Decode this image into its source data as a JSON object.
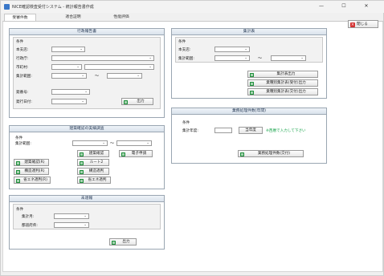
{
  "window": {
    "title": "NICE確認検査受付システム - 統計報告書作成",
    "minimize": "—",
    "maximize": "☐",
    "close": "✕"
  },
  "tabs": [
    {
      "label": "受審件数"
    },
    {
      "label": "適合証明"
    },
    {
      "label": "性能評価"
    }
  ],
  "close_button": {
    "label": "閉じる"
  },
  "gyosei": {
    "title": "行政報告書",
    "group_label": "条件",
    "honshiten_label": "本支店:",
    "gyoseicho_label": "行政庁:",
    "shikuchoson_label": "市町村:",
    "shukei_label": "集計範囲:",
    "tilde": "～",
    "bango_label": "発番号:",
    "hakko_label": "発行日付:",
    "output_btn": "出力"
  },
  "shukeihyo": {
    "title": "集計表",
    "group_label": "条件",
    "honshiten_label": "本支店:",
    "shukei_label": "集計範囲:",
    "tilde": "～",
    "btn1": "集計表出力",
    "btn2": "業種別集計表(受付)出力",
    "btn3": "業種別集計表(交付)出力"
  },
  "gyomu": {
    "title": "業務処理件数(年間)",
    "group_label": "条件",
    "nendo_label": "集計年度:",
    "year_btn": "当年度",
    "hint": "※西暦で入力して下さい",
    "output_btn": "業務処理件数(交付)"
  },
  "kakunin": {
    "title": "建築確認の実績調査",
    "group_label": "条件",
    "shukei_label": "集計範囲:",
    "tilde": "～",
    "btn_kenchiku": "建築確認",
    "btn_denshi": "電子申請",
    "btn_kenchiku_r": "建築確認(R)",
    "btn_route2": "ルート2",
    "btn_kozo_r": "構造適判(R)",
    "btn_kozo": "構造適判",
    "btn_shoene_r": "省エネ適判(R)",
    "btn_shoene": "省エネ適判"
  },
  "mitatsu": {
    "title": "未達報",
    "group_label": "条件",
    "tsuki_label": "集計月:",
    "todokede_label": "都道府県:",
    "output_btn": "出力"
  }
}
